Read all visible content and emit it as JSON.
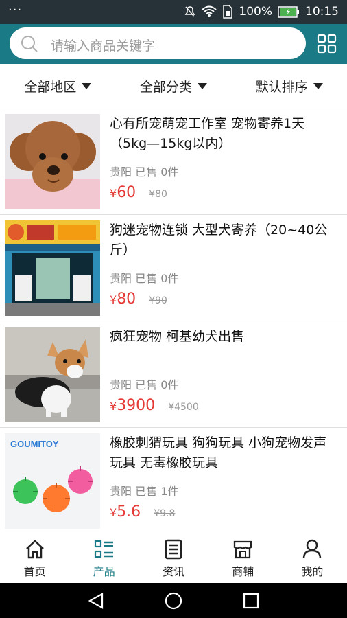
{
  "status": {
    "battery": "100%",
    "time": "10:15"
  },
  "search": {
    "placeholder": "请输入商品关键字"
  },
  "filters": [
    {
      "label": "全部地区"
    },
    {
      "label": "全部分类"
    },
    {
      "label": "默认排序"
    }
  ],
  "products": [
    {
      "title": "心有所宠萌宠工作室 宠物寄养1天（5kg—15kg以内）",
      "location": "贵阳",
      "sold": "已售 0件",
      "currency": "¥",
      "price": "60",
      "original": "¥80"
    },
    {
      "title": "狗迷宠物连锁 大型犬寄养（20~40公斤）",
      "location": "贵阳",
      "sold": "已售 0件",
      "currency": "¥",
      "price": "80",
      "original": "¥90"
    },
    {
      "title": "疯狂宠物 柯基幼犬出售",
      "location": "贵阳",
      "sold": "已售 0件",
      "currency": "¥",
      "price": "3900",
      "original": "¥4500"
    },
    {
      "title": "橡胶刺猬玩具 狗狗玩具 小狗宠物发声玩具 无毒橡胶玩具",
      "location": "贵阳",
      "sold": "已售 1件",
      "currency": "¥",
      "price": "5.6",
      "original": "¥9.8",
      "image_text": "GOUMITOY"
    }
  ],
  "tabs": [
    {
      "label": "首页",
      "icon": "home-icon"
    },
    {
      "label": "产品",
      "icon": "list-icon",
      "active": true
    },
    {
      "label": "资讯",
      "icon": "news-icon"
    },
    {
      "label": "商铺",
      "icon": "shop-icon"
    },
    {
      "label": "我的",
      "icon": "user-icon"
    }
  ],
  "colors": {
    "accent": "#1a7a85",
    "price": "#e53935"
  }
}
